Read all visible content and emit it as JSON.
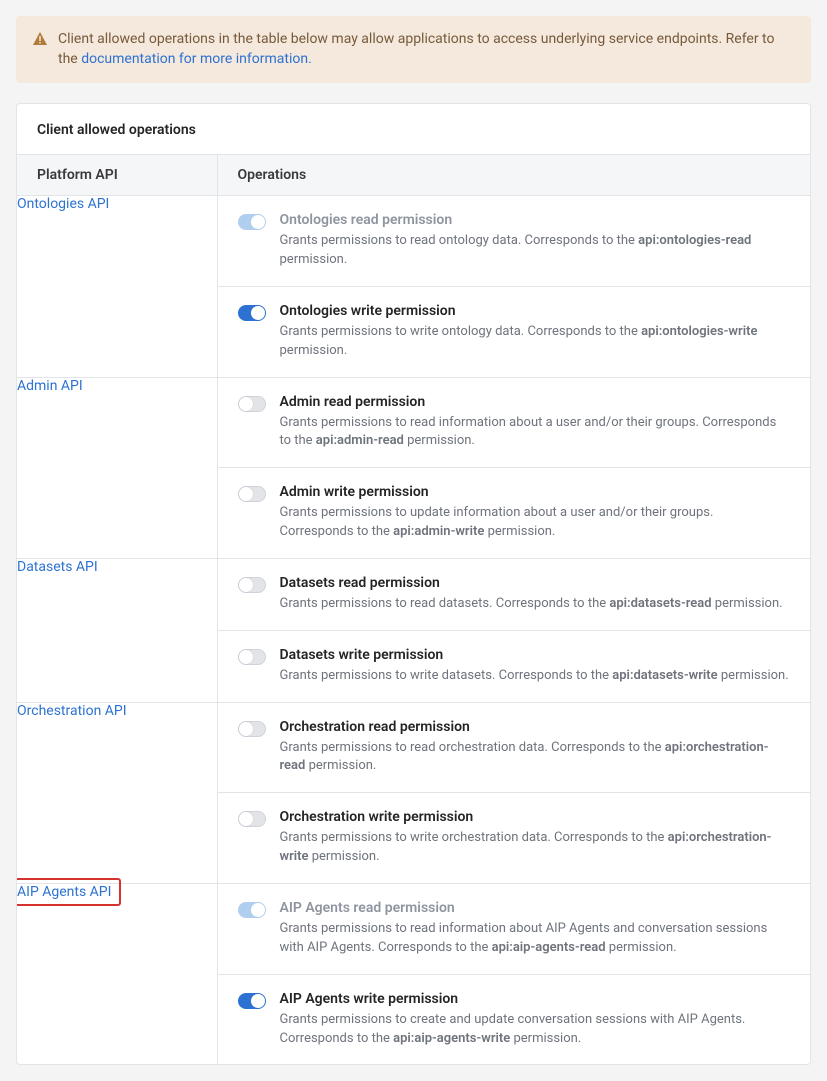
{
  "alert": {
    "text": "Client allowed operations in the table below may allow applications to access underlying service endpoints. Refer to the ",
    "link": "documentation for more information."
  },
  "panel_title": "Client allowed operations",
  "headers": {
    "col1": "Platform API",
    "col2": "Operations"
  },
  "rows": [
    {
      "api": "Ontologies API",
      "highlight": false,
      "ops": [
        {
          "state": "on-disabled",
          "title": "Ontologies read permission",
          "title_disabled": true,
          "desc_pre": "Grants permissions to read ontology data. Corresponds to the ",
          "desc_bold": "api:ontologies-read",
          "desc_post": " permission."
        },
        {
          "state": "on",
          "title": "Ontologies write permission",
          "title_disabled": false,
          "desc_pre": "Grants permissions to write ontology data. Corresponds to the ",
          "desc_bold": "api:ontologies-write",
          "desc_post": " permission."
        }
      ]
    },
    {
      "api": "Admin API",
      "highlight": false,
      "ops": [
        {
          "state": "off",
          "title": "Admin read permission",
          "title_disabled": false,
          "desc_pre": "Grants permissions to read information about a user and/or their groups. Corresponds to the ",
          "desc_bold": "api:admin-read",
          "desc_post": " permission."
        },
        {
          "state": "off",
          "title": "Admin write permission",
          "title_disabled": false,
          "desc_pre": "Grants permissions to update information about a user and/or their groups. Corresponds to the ",
          "desc_bold": "api:admin-write",
          "desc_post": " permission."
        }
      ]
    },
    {
      "api": "Datasets API",
      "highlight": false,
      "ops": [
        {
          "state": "off",
          "title": "Datasets read permission",
          "title_disabled": false,
          "desc_pre": "Grants permissions to read datasets. Corresponds to the ",
          "desc_bold": "api:datasets-read",
          "desc_post": " permission."
        },
        {
          "state": "off",
          "title": "Datasets write permission",
          "title_disabled": false,
          "desc_pre": "Grants permissions to write datasets. Corresponds to the ",
          "desc_bold": "api:datasets-write",
          "desc_post": " permission."
        }
      ]
    },
    {
      "api": "Orchestration API",
      "highlight": false,
      "ops": [
        {
          "state": "off",
          "title": "Orchestration read permission",
          "title_disabled": false,
          "desc_pre": "Grants permissions to read orchestration data. Corresponds to the ",
          "desc_bold": "api:orchestration-read",
          "desc_post": " permission."
        },
        {
          "state": "off",
          "title": "Orchestration write permission",
          "title_disabled": false,
          "desc_pre": "Grants permissions to write orchestration data. Corresponds to the ",
          "desc_bold": "api:orchestration-write",
          "desc_post": " permission."
        }
      ]
    },
    {
      "api": "AIP Agents API",
      "highlight": true,
      "ops": [
        {
          "state": "on-disabled",
          "title": "AIP Agents read permission",
          "title_disabled": true,
          "desc_pre": "Grants permissions to read information about AIP Agents and conversation sessions with AIP Agents. Corresponds to the ",
          "desc_bold": "api:aip-agents-read",
          "desc_post": " permission."
        },
        {
          "state": "on",
          "title": "AIP Agents write permission",
          "title_disabled": false,
          "desc_pre": "Grants permissions to create and update conversation sessions with AIP Agents. Corresponds to the ",
          "desc_bold": "api:aip-agents-write",
          "desc_post": " permission."
        }
      ]
    }
  ]
}
